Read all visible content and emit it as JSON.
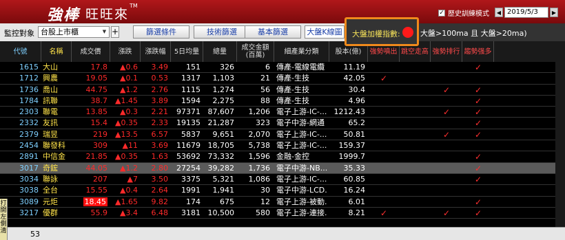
{
  "app": {
    "brand_main": "強棒",
    "brand_sub": "旺旺來",
    "brand_tm": "TM",
    "history_mode_label": "歷史訓練模式",
    "history_mode_checked": true,
    "date_prev": "◀",
    "date_value": "2019/5/3",
    "date_next": "▶"
  },
  "toolbar": {
    "monitor_label": "監控對象",
    "monitor_value": "台股上市櫃",
    "plus_label": "+",
    "filter_button": "篩選條件",
    "tech_filter_button": "技術篩選",
    "fund_filter_button": "基本篩選",
    "kline_button": "大盤K線圖",
    "index_label": "大盤加權指數:",
    "index_status_color": "#ff1a1a",
    "index_condition": "大盤>100ma 且 大盤>20ma)"
  },
  "columns": [
    "代號",
    "名稱",
    "成交價",
    "漲跌",
    "漲跌幅",
    "5日均量",
    "總量",
    "成交金額(百萬)",
    "細產業分類",
    "股本(億)",
    "強勢噴出",
    "跳空走高",
    "強勢排行",
    "趨勢强多"
  ],
  "rows": [
    {
      "code": "1615",
      "name": "大山",
      "price": "17.8",
      "chg": "▲0.6",
      "pct": "3.49",
      "ma5": "151",
      "vol": "326",
      "amt": "6",
      "ind": "傳產-電線電纜",
      "cap": "11.19",
      "c1": "",
      "c2": "",
      "c3": "",
      "c4": "✓",
      "selected": false
    },
    {
      "code": "1712",
      "name": "興農",
      "price": "19.05",
      "chg": "▲0.1",
      "pct": "0.53",
      "ma5": "1317",
      "vol": "1,103",
      "amt": "21",
      "ind": "傳產-生技",
      "cap": "42.05",
      "c1": "✓",
      "c2": "",
      "c3": "",
      "c4": "",
      "selected": false
    },
    {
      "code": "1736",
      "name": "喬山",
      "price": "44.75",
      "chg": "▲1.2",
      "pct": "2.76",
      "ma5": "1115",
      "vol": "1,274",
      "amt": "56",
      "ind": "傳產-生技",
      "cap": "30.4",
      "c1": "",
      "c2": "",
      "c3": "✓",
      "c4": "✓",
      "selected": false
    },
    {
      "code": "1784",
      "name": "訊聯",
      "price": "38.7",
      "chg": "▲1.45",
      "pct": "3.89",
      "ma5": "1594",
      "vol": "2,275",
      "amt": "88",
      "ind": "傳產-生技",
      "cap": "4.96",
      "c1": "",
      "c2": "",
      "c3": "",
      "c4": "✓",
      "selected": false
    },
    {
      "code": "2303",
      "name": "聯電",
      "price": "13.85",
      "chg": "▲0.3",
      "pct": "2.21",
      "ma5": "97371",
      "vol": "87,607",
      "amt": "1,206",
      "ind": "電子上游-IC-...",
      "cap": "1212.43",
      "c1": "",
      "c2": "",
      "c3": "✓",
      "c4": "✓",
      "selected": false
    },
    {
      "code": "2332",
      "name": "友訊",
      "price": "15.4",
      "chg": "▲0.35",
      "pct": "2.33",
      "ma5": "19135",
      "vol": "21,287",
      "amt": "323",
      "ind": "電子中游-網通",
      "cap": "65.2",
      "c1": "",
      "c2": "",
      "c3": "",
      "c4": "✓",
      "selected": false
    },
    {
      "code": "2379",
      "name": "瑞昱",
      "price": "219",
      "chg": "▲13.5",
      "pct": "6.57",
      "ma5": "5837",
      "vol": "9,651",
      "amt": "2,070",
      "ind": "電子上游-IC-...",
      "cap": "50.81",
      "c1": "",
      "c2": "",
      "c3": "✓",
      "c4": "✓",
      "selected": false
    },
    {
      "code": "2454",
      "name": "聯發科",
      "price": "309",
      "chg": "▲11",
      "pct": "3.69",
      "ma5": "11679",
      "vol": "18,705",
      "amt": "5,738",
      "ind": "電子上游-IC-...",
      "cap": "159.37",
      "c1": "",
      "c2": "",
      "c3": "",
      "c4": "",
      "selected": false
    },
    {
      "code": "2891",
      "name": "中信金",
      "price": "21.85",
      "chg": "▲0.35",
      "pct": "1.63",
      "ma5": "53692",
      "vol": "73,332",
      "amt": "1,596",
      "ind": "金融-金控",
      "cap": "1999.7",
      "c1": "",
      "c2": "",
      "c3": "",
      "c4": "✓",
      "selected": false
    },
    {
      "code": "3017",
      "name": "奇鋐",
      "price": "44.05",
      "chg": "▲1.2",
      "pct": "2.80",
      "ma5": "27254",
      "vol": "39,282",
      "amt": "1,736",
      "ind": "電子中游-NB...",
      "cap": "35.33",
      "c1": "",
      "c2": "",
      "c3": "",
      "c4": "✓",
      "selected": true
    },
    {
      "code": "3034",
      "name": "聯詠",
      "price": "207",
      "chg": "▲7",
      "pct": "3.50",
      "ma5": "3375",
      "vol": "5,321",
      "amt": "1,086",
      "ind": "電子上游-IC-...",
      "cap": "60.85",
      "c1": "",
      "c2": "",
      "c3": "",
      "c4": "✓",
      "selected": false
    },
    {
      "code": "3038",
      "name": "全台",
      "price": "15.55",
      "chg": "▲0.4",
      "pct": "2.64",
      "ma5": "1991",
      "vol": "1,941",
      "amt": "30",
      "ind": "電子中游-LCD...",
      "cap": "16.24",
      "c1": "",
      "c2": "",
      "c3": "",
      "c4": "",
      "selected": false
    },
    {
      "code": "3089",
      "name": "元炬",
      "price": "18.45",
      "chg": "▲1.65",
      "pct": "9.82",
      "ma5": "174",
      "vol": "675",
      "amt": "12",
      "ind": "電子上游-被動...",
      "cap": "6.01",
      "c1": "",
      "c2": "",
      "c3": "",
      "c4": "✓",
      "selected": false,
      "price_box": true
    },
    {
      "code": "3217",
      "name": "優群",
      "price": "55.9",
      "chg": "▲3.4",
      "pct": "6.48",
      "ma5": "3181",
      "vol": "10,500",
      "amt": "580",
      "ind": "電子上游-連接...",
      "cap": "8.21",
      "c1": "✓",
      "c2": "",
      "c3": "✓",
      "c4": "✓",
      "selected": false
    }
  ],
  "side_tab": "打開左側清",
  "footer": {
    "count": "53"
  }
}
